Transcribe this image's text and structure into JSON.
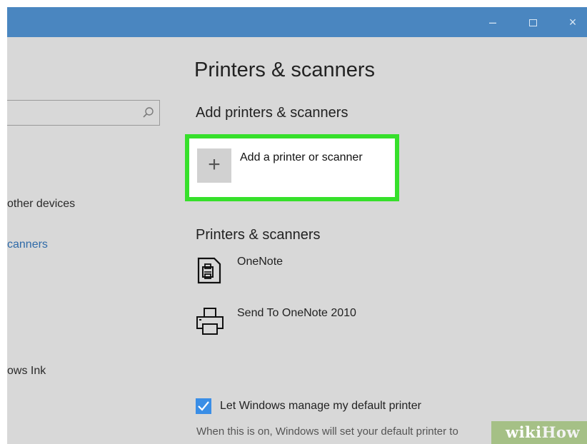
{
  "window": {
    "minimize_glyph": "–",
    "close_glyph": "×"
  },
  "sidebar": {
    "items": [
      {
        "label": "other devices"
      },
      {
        "label": "canners"
      },
      {
        "label": "ows Ink"
      }
    ]
  },
  "main": {
    "title": "Printers & scanners",
    "add_section": {
      "heading": "Add printers & scanners",
      "plus_glyph": "+",
      "add_label": "Add a printer or scanner"
    },
    "list_section": {
      "heading": "Printers & scanners",
      "printers": [
        {
          "name": "OneNote",
          "icon": "fax-printer-icon"
        },
        {
          "name": "Send To OneNote 2010",
          "icon": "printer-icon"
        }
      ]
    },
    "default_printer": {
      "checked": true,
      "label": "Let Windows manage my default printer",
      "description": "When this is on, Windows will set your default printer to"
    }
  },
  "watermark": {
    "part_a": "wiki",
    "part_b": "How"
  },
  "colors": {
    "titlebar": "#4a86c0",
    "highlight": "#36e02b",
    "link": "#2f6aa8",
    "checkbox": "#3a8ee6"
  }
}
